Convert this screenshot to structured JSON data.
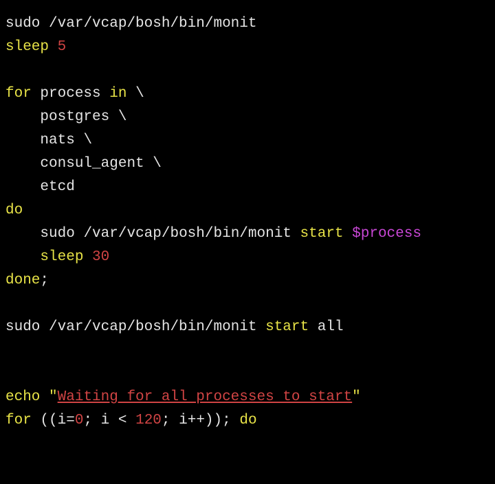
{
  "code": {
    "line1_sudo": "sudo",
    "line1_path": "/var/vcap/bosh/bin/monit",
    "line2_sleep": "sleep",
    "line2_num": "5",
    "line4_for": "for",
    "line4_process": "process",
    "line4_in": "in",
    "line4_bs": "\\",
    "line5_postgres": "postgres",
    "line5_bs": "\\",
    "line6_nats": "nats",
    "line6_bs": "\\",
    "line7_consul": "consul_agent",
    "line7_bs": "\\",
    "line8_etcd": "etcd",
    "line9_do": "do",
    "line10_sudo": "sudo",
    "line10_path": "/var/vcap/bosh/bin/monit",
    "line10_start": "start",
    "line10_var": "$process",
    "line11_sleep": "sleep",
    "line11_num": "30",
    "line12_done": "done",
    "line12_semi": ";",
    "line14_sudo": "sudo",
    "line14_path": "/var/vcap/bosh/bin/monit",
    "line14_start": "start",
    "line14_all": "all",
    "line17_echo": "echo",
    "line17_q1": "\"",
    "line17_str": "Waiting for all processes to start",
    "line17_q2": "\"",
    "line18_for": "for",
    "line18_open": "((i",
    "line18_eq": "=",
    "line18_zero": "0",
    "line18_semi1": "; i ",
    "line18_lt": "<",
    "line18_sp": " ",
    "line18_120": "120",
    "line18_rest": "; i++));",
    "line18_do": "do"
  }
}
